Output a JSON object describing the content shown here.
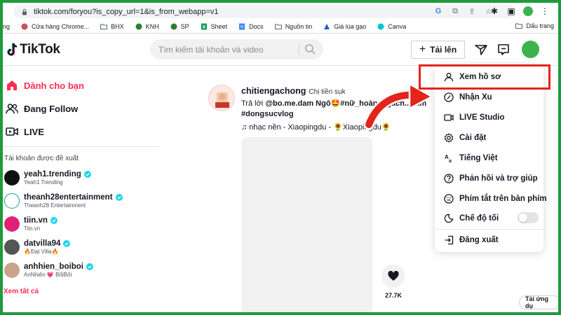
{
  "browser": {
    "url": "tiktok.com/foryou?is_copy_url=1&is_from_webapp=v1",
    "bookmarks": [
      {
        "label": "ng",
        "icon": "page-icon"
      },
      {
        "label": "Cửa hàng Chrome...",
        "icon": "chrome-store-icon"
      },
      {
        "label": "BHX",
        "icon": "folder-icon"
      },
      {
        "label": "KNH",
        "icon": "site-icon"
      },
      {
        "label": "SP",
        "icon": "site-icon"
      },
      {
        "label": "Sheet",
        "icon": "sheets-icon"
      },
      {
        "label": "Docs",
        "icon": "docs-icon"
      },
      {
        "label": "Nguồn tin",
        "icon": "folder-icon"
      },
      {
        "label": "Giá lúa gạo",
        "icon": "site-icon"
      },
      {
        "label": "Canva",
        "icon": "canva-icon"
      }
    ],
    "bookmark_right": "Dấu trang"
  },
  "header": {
    "logo_text": "TikTok",
    "search_placeholder": "Tìm kiếm tài khoản và video",
    "upload_label": "Tải lên"
  },
  "sidebar": {
    "nav": [
      {
        "label": "Dành cho bạn",
        "icon": "home-icon",
        "active": true
      },
      {
        "label": "Đang Follow",
        "icon": "following-icon",
        "active": false
      },
      {
        "label": "LIVE",
        "icon": "live-icon",
        "active": false
      }
    ],
    "suggested_title": "Tài khoản được đề xuất",
    "accounts": [
      {
        "name": "yeah1.trending",
        "sub": "Yeah1 Trending",
        "color": "#111111"
      },
      {
        "name": "theanh28entertainment",
        "sub": "Theanh28 Entertainment",
        "color": "#1aa37a"
      },
      {
        "name": "tiin.vn",
        "sub": "Tiin.vn",
        "color": "#e0217a"
      },
      {
        "name": "datvilla94",
        "sub": "🔥Đạt Villa🔥",
        "color": "#555555"
      },
      {
        "name": "anhhien_boiboi",
        "sub": "AnNhiên 💗 BốiBối",
        "color": "#c9a48a"
      }
    ],
    "see_all": "Xem tất cả"
  },
  "post": {
    "username": "chitiengachong",
    "nickname": "Chị tiền sụk",
    "caption_prefix": "Trả lời ",
    "caption_mention": "@bo.me.dam",
    "caption_rest": " Ngô🤩#nữ_hoàng_gach...cẩm",
    "hashtag_line": "#dongsucvlog",
    "music": "♫ nhạc nền - Xiaopingdu - 🌻Xiaopingdu🌻",
    "like_count": "27.7K"
  },
  "menu": {
    "items": [
      {
        "label": "Xem hồ sơ",
        "icon": "user-icon"
      },
      {
        "label": "Nhận Xu",
        "icon": "coin-icon"
      },
      {
        "label": "LIVE Studio",
        "icon": "live-studio-icon"
      },
      {
        "label": "Cài đặt",
        "icon": "gear-icon"
      },
      {
        "label": "Tiếng Việt",
        "icon": "language-icon"
      },
      {
        "label": "Phản hồi và trợ giúp",
        "icon": "help-icon"
      },
      {
        "label": "Phím tắt trên bàn phím",
        "icon": "keyboard-icon"
      },
      {
        "label": "Chế độ tối",
        "icon": "moon-icon"
      },
      {
        "label": "Đăng xuất",
        "icon": "logout-icon"
      }
    ],
    "dark_mode_on": false
  },
  "get_app": "Tải ứng dụ",
  "colors": {
    "accent": "#fe2c55",
    "highlight": "#e3241b",
    "frame": "#1e9b3c"
  }
}
